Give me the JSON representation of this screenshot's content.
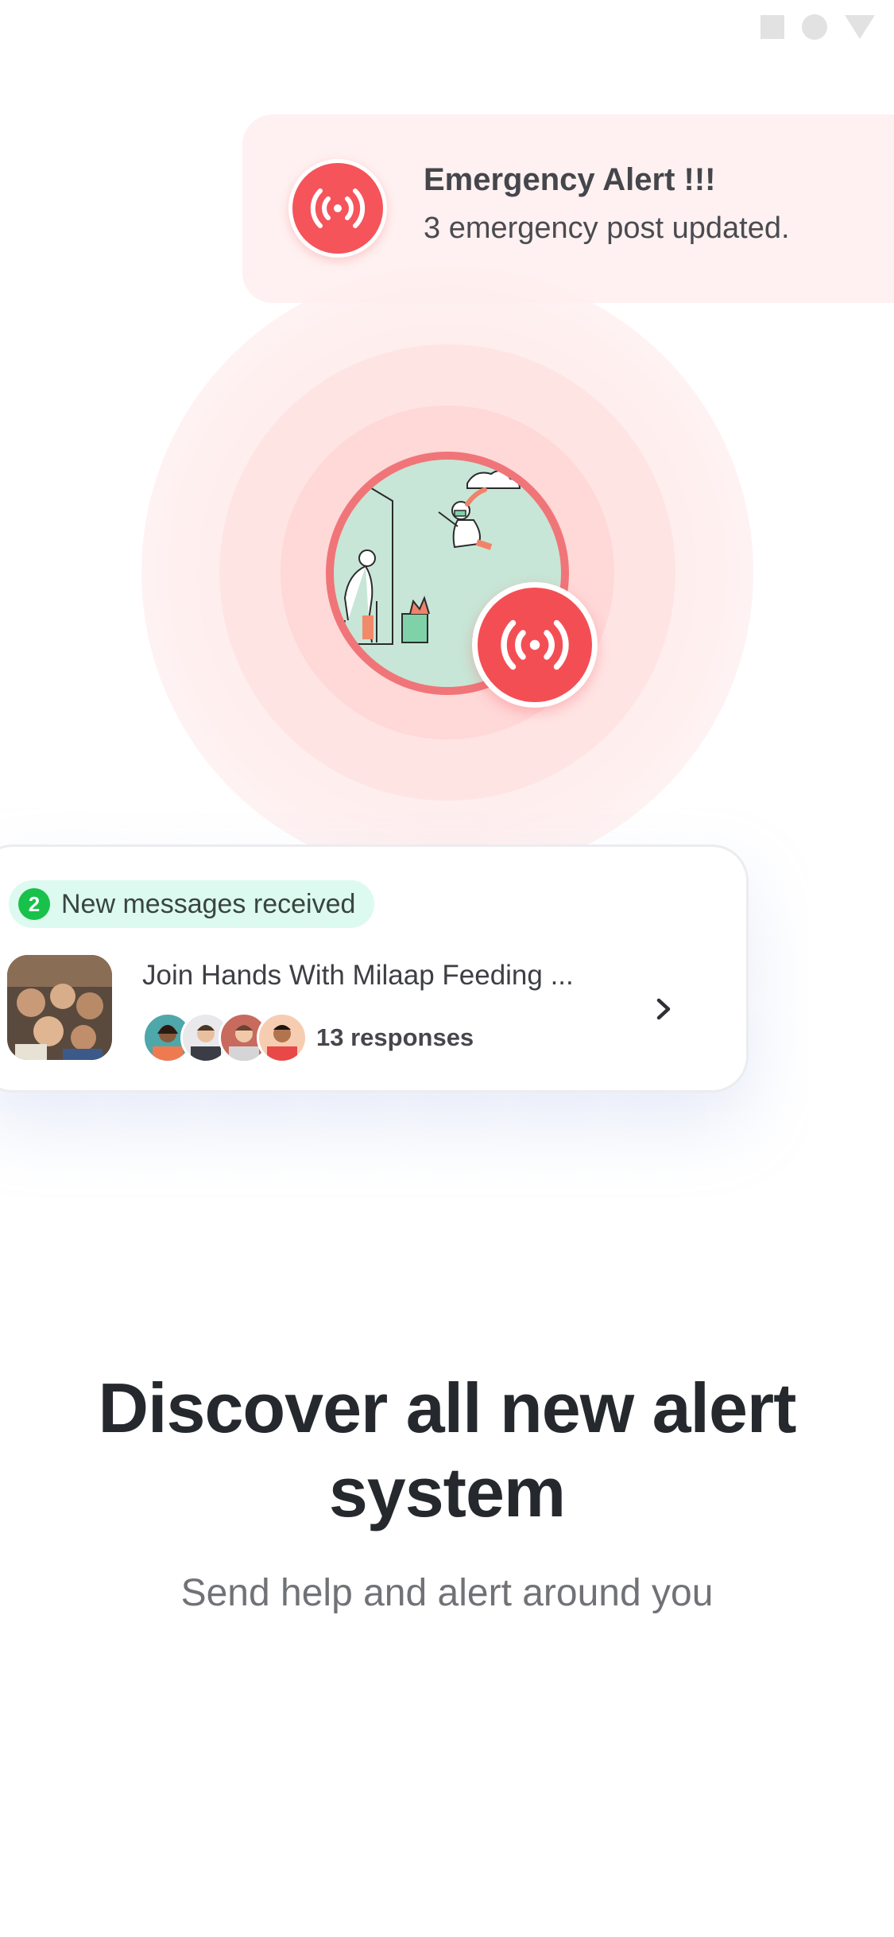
{
  "colors": {
    "accent_red": "#f5545a",
    "alert_bg": "#fff1f1",
    "pill_bg": "#dcfaef",
    "pill_count_green": "#17c14a"
  },
  "status_bar": {
    "icons": [
      "square-icon",
      "circle-icon",
      "triangle-icon"
    ]
  },
  "alert": {
    "icon": "broadcast-icon",
    "title": "Emergency Alert !!!",
    "subtitle": "3 emergency post updated."
  },
  "illustration": {
    "badge_icon": "broadcast-icon"
  },
  "messages_card": {
    "count": "2",
    "label": "New messages received",
    "post_title": "Join Hands With Milaap Feeding ...",
    "responses": "13 responses",
    "chevron_icon": "chevron-right-icon"
  },
  "headline": "Discover all new alert system",
  "subline": "Send help and alert around you"
}
